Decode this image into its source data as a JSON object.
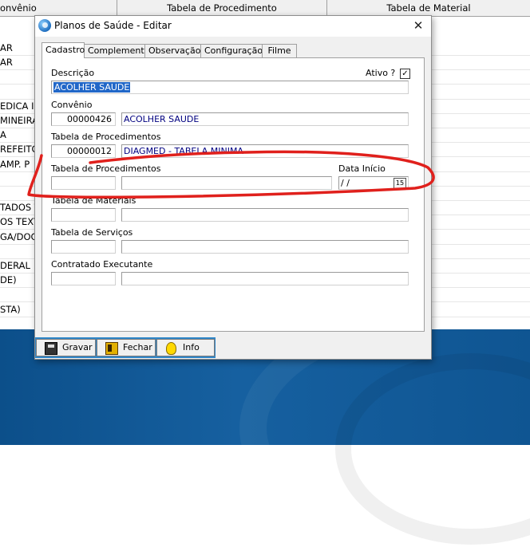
{
  "background_table": {
    "headers": [
      "onvênio",
      "Tabela de Procedimento",
      "Tabela de Material"
    ],
    "rows": [
      "AR",
      "AR",
      "",
      "",
      "EDICA INT",
      "MINEIRA",
      "A",
      "REFEITO",
      "AMP. P",
      "",
      "",
      "TADOS T",
      "OS TEXTE",
      "GA/DOG",
      "",
      "DERAL",
      "DE)",
      "",
      "STA)"
    ]
  },
  "dialog": {
    "title": "Planos de Saúde - Editar",
    "close_symbol": "✕",
    "tabs": [
      "Cadastro",
      "Complemento",
      "Observação",
      "Configuração",
      "Filme"
    ],
    "active_tab": "Cadastro",
    "fields": {
      "descricao_label": "Descrição",
      "descricao_value": "ACOLHER SAUDE",
      "ativo_label": "Ativo ?",
      "ativo_checked": "✓",
      "convenio_label": "Convênio",
      "convenio_code": "00000426",
      "convenio_name": "ACOLHER SAUDE",
      "tabela_proc_label": "Tabela de Procedimentos",
      "tabela_proc_code": "00000012",
      "tabela_proc_name": "DIAGMED - TABELA MINIMA",
      "tabela_proc2_label": "Tabela de Procedimentos",
      "tabela_proc2_code": "",
      "tabela_proc2_name": "",
      "data_inicio_label": "Data Início",
      "data_inicio_value": " /  /",
      "calendar_glyph": "15",
      "tabela_mat_label": "Tabela de Materiais",
      "tabela_mat_code": "",
      "tabela_mat_name": "",
      "tabela_serv_label": "Tabela de Serviços",
      "tabela_serv_code": "",
      "tabela_serv_name": "",
      "contratado_label": "Contratado Executante",
      "contratado_code": "",
      "contratado_name": ""
    },
    "buttons": {
      "gravar": "Gravar",
      "fechar": "Fechar",
      "info": "Info"
    }
  },
  "colors": {
    "selection": "#2167c8",
    "annotation": "#e0201c",
    "button_bar": "#2f86c8",
    "taskbar": "#0f5592"
  }
}
